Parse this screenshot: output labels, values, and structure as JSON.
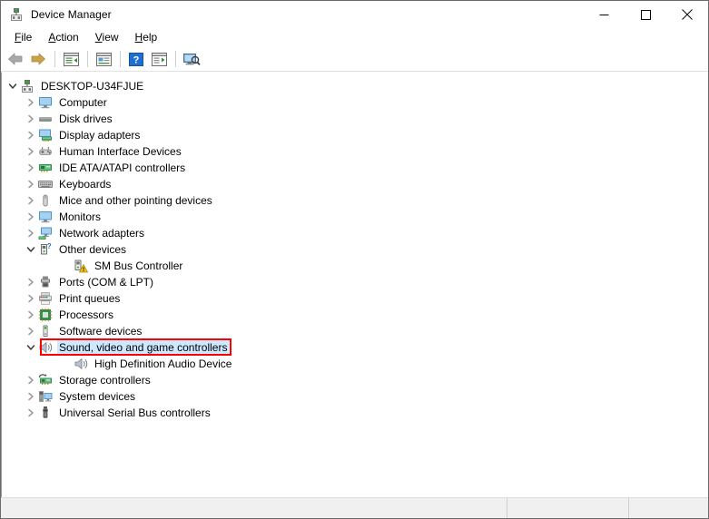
{
  "window": {
    "title": "Device Manager",
    "icon": "device-manager-icon"
  },
  "caption": {
    "minimize_label": "Minimize",
    "maximize_label": "Maximize",
    "close_label": "Close"
  },
  "menu": {
    "items": [
      {
        "label": "File",
        "accel": "F"
      },
      {
        "label": "Action",
        "accel": "A"
      },
      {
        "label": "View",
        "accel": "V"
      },
      {
        "label": "Help",
        "accel": "H"
      }
    ]
  },
  "toolbar": {
    "buttons": [
      {
        "name": "back-button",
        "icon": "back-arrow-icon"
      },
      {
        "name": "forward-button",
        "icon": "forward-arrow-icon"
      },
      {
        "name": "show-hide-console-tree",
        "icon": "console-tree-icon"
      },
      {
        "name": "properties-button",
        "icon": "properties-icon"
      },
      {
        "name": "help-button",
        "icon": "help-question-icon"
      },
      {
        "name": "scan-hardware-changes",
        "icon": "scan-changes-icon"
      },
      {
        "name": "update-driver-button",
        "icon": "update-driver-icon"
      }
    ]
  },
  "colors": {
    "selection": "#cde8ff",
    "annotation": "#ff0000",
    "window_border": "#6a6a6a",
    "status_bg": "#f0f0f0"
  },
  "tree": {
    "root": {
      "label": "DESKTOP-U34FJUE",
      "icon": "computer-root-icon",
      "expanded": true
    },
    "nodes": [
      {
        "label": "Computer",
        "icon": "monitor-icon",
        "expanded": false,
        "level": 1
      },
      {
        "label": "Disk drives",
        "icon": "disk-drive-icon",
        "expanded": false,
        "level": 1
      },
      {
        "label": "Display adapters",
        "icon": "display-adapter-icon",
        "expanded": false,
        "level": 1
      },
      {
        "label": "Human Interface Devices",
        "icon": "hid-gamepad-icon",
        "expanded": false,
        "level": 1
      },
      {
        "label": "IDE ATA/ATAPI controllers",
        "icon": "ide-controller-icon",
        "expanded": false,
        "level": 1
      },
      {
        "label": "Keyboards",
        "icon": "keyboard-icon",
        "expanded": false,
        "level": 1
      },
      {
        "label": "Mice and other pointing devices",
        "icon": "mouse-icon",
        "expanded": false,
        "level": 1
      },
      {
        "label": "Monitors",
        "icon": "monitor-icon",
        "expanded": false,
        "level": 1
      },
      {
        "label": "Network adapters",
        "icon": "network-adapter-icon",
        "expanded": false,
        "level": 1
      },
      {
        "label": "Other devices",
        "icon": "other-device-icon",
        "expanded": true,
        "level": 1
      },
      {
        "label": "SM Bus Controller",
        "icon": "warning-device-icon",
        "expanded": null,
        "level": 2
      },
      {
        "label": "Ports (COM & LPT)",
        "icon": "port-icon",
        "expanded": false,
        "level": 1
      },
      {
        "label": "Print queues",
        "icon": "printer-icon",
        "expanded": false,
        "level": 1
      },
      {
        "label": "Processors",
        "icon": "processor-icon",
        "expanded": false,
        "level": 1
      },
      {
        "label": "Software devices",
        "icon": "software-device-icon",
        "expanded": false,
        "level": 1
      },
      {
        "label": "Sound, video and game controllers",
        "icon": "speaker-icon",
        "expanded": true,
        "level": 1,
        "selected": true,
        "annotated": true
      },
      {
        "label": "High Definition Audio Device",
        "icon": "speaker-icon",
        "expanded": null,
        "level": 2
      },
      {
        "label": "Storage controllers",
        "icon": "storage-controller-icon",
        "expanded": false,
        "level": 1
      },
      {
        "label": "System devices",
        "icon": "system-device-icon",
        "expanded": false,
        "level": 1
      },
      {
        "label": "Universal Serial Bus controllers",
        "icon": "usb-icon",
        "expanded": false,
        "level": 1
      }
    ]
  },
  "statusbar": {
    "pane1": "",
    "pane2": "",
    "pane3": ""
  }
}
